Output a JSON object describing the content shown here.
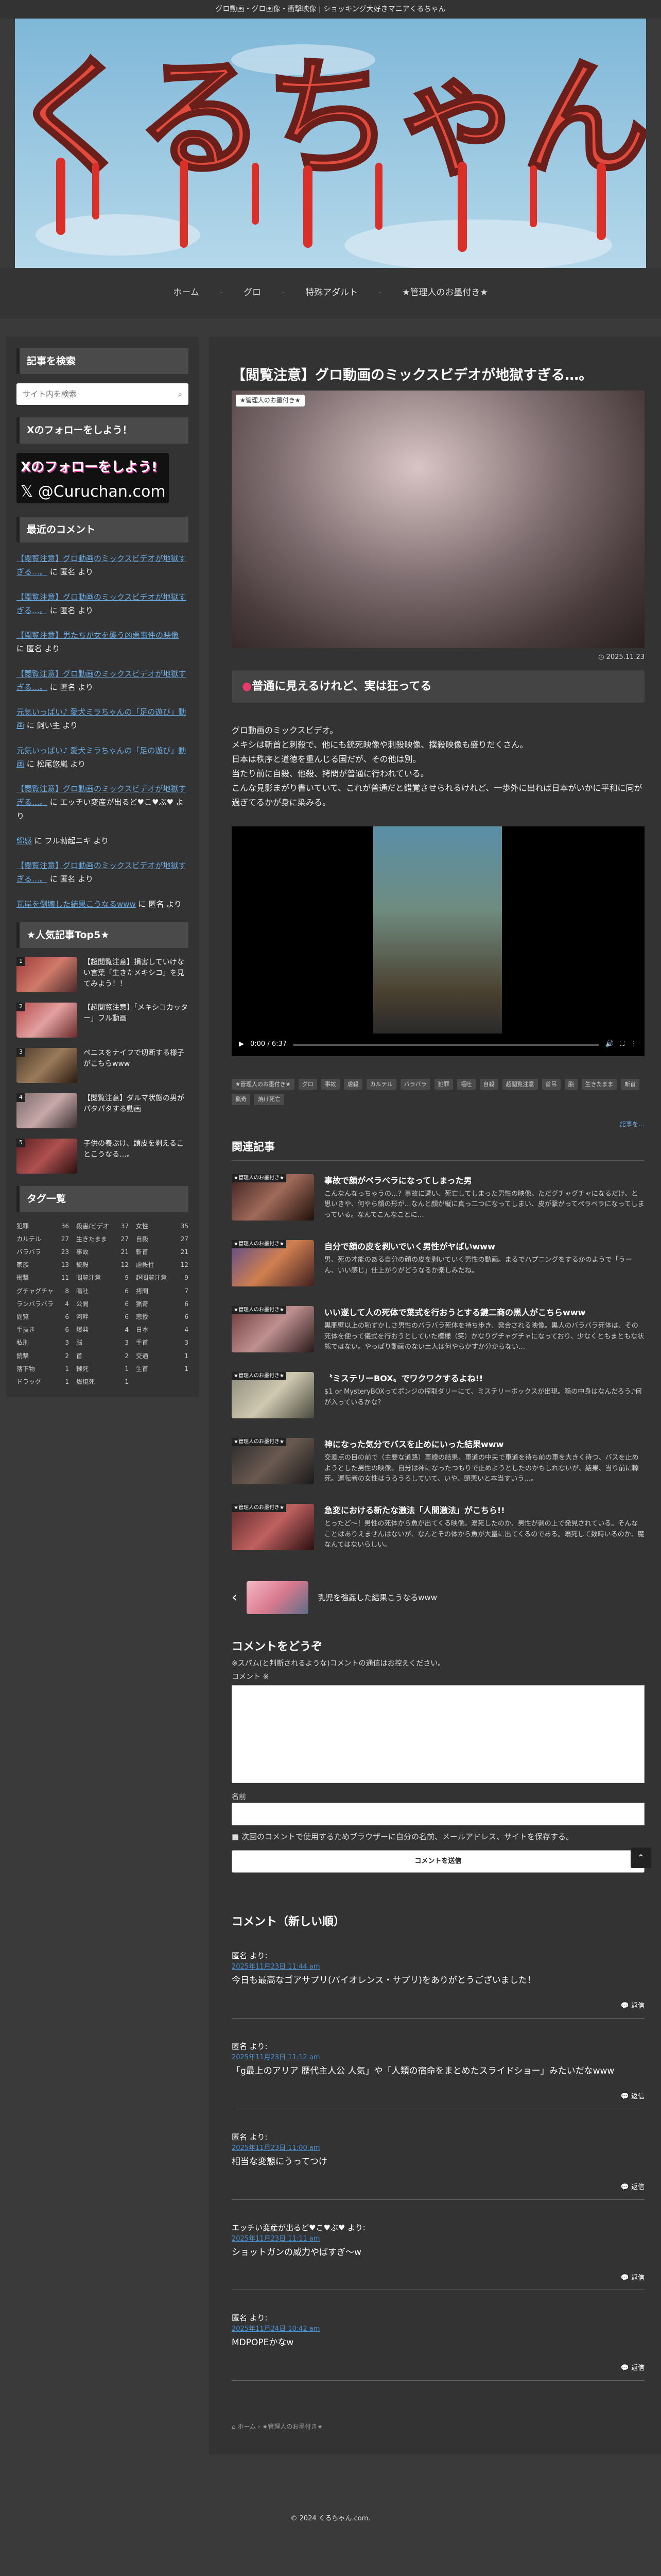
{
  "topbar": "グロ動画・グロ画像・衝撃映像 | ショッキング大好きマニアくるちゃん",
  "logo": "くるちゃん",
  "nav": [
    "ホーム",
    "グロ",
    "特殊アダルト",
    "★管理人のお墨付き★"
  ],
  "sidebar": {
    "search_title": "記事を検索",
    "search_placeholder": "サイト内を検索",
    "follow_title": "Xのフォローをしよう！",
    "follow_line1": "Xのフォローをしよう!",
    "follow_line2": "@Curuchan.com",
    "recent_title": "最近のコメント",
    "recent": [
      {
        "link": "【閲覧注意】グロ動画のミックスビデオが地獄すぎる…。",
        "rest": " に 匿名 より"
      },
      {
        "link": "【閲覧注意】グロ動画のミックスビデオが地獄すぎる…。",
        "rest": " に 匿名 より"
      },
      {
        "link": "【閲覧注意】男たちが女を襲う凶悪事件の映像",
        "rest": " に 匿名 より"
      },
      {
        "link": "【閲覧注意】グロ動画のミックスビデオが地獄すぎる…。",
        "rest": " に 匿名 より"
      },
      {
        "link": "元気いっぱい♪ 愛犬ミラちゃんの「足の遊び」動画",
        "rest": " に 飼い主 より"
      },
      {
        "link": "元気いっぱい♪ 愛犬ミラちゃんの「足の遊び」動画",
        "rest": " に 松尾悠嵐 より"
      },
      {
        "link": "【閲覧注意】グロ動画のミックスビデオが地獄すぎる…。",
        "rest": " に エッチい変産が出るど♥こ♥ぶ♥ より"
      },
      {
        "link": "綿感",
        "rest": " に フル勃起ニキ より"
      },
      {
        "link": "【閲覧注意】グロ動画のミックスビデオが地獄すぎる…。",
        "rest": " に 匿名 より"
      },
      {
        "link": "瓦岸を倒壊した結果こうなるwww",
        "rest": " に 匿名 より"
      }
    ],
    "popular_title": "★人気記事Top5★",
    "popular": [
      {
        "rank": "1",
        "title": "【超閲覧注意】損害していけない言葉「生きたメキシコ」を見てみよう！！"
      },
      {
        "rank": "2",
        "title": "【超閲覧注意】「メキシコカッター」フル動画"
      },
      {
        "rank": "3",
        "title": "ペニスをナイフで切断する様子がこちらwww"
      },
      {
        "rank": "4",
        "title": "【閲覧注意】ダルマ状態の男がパタパタする動画"
      },
      {
        "rank": "5",
        "title": "子供の養ぶけ、頭皮を剥えることこうなる…。"
      }
    ],
    "tags_title": "タグ一覧",
    "tags": [
      [
        "犯罪",
        "36"
      ],
      [
        "殺害/ビデオ",
        "37"
      ],
      [
        "女性",
        "35"
      ],
      [
        "カルテル",
        "27"
      ],
      [
        "生きたまま",
        "27"
      ],
      [
        "自殺",
        "27"
      ],
      [
        "バラバラ",
        "23"
      ],
      [
        "事故",
        "21"
      ],
      [
        "斬首",
        "21"
      ],
      [
        "家族",
        "13"
      ],
      [
        "銃殺",
        "12"
      ],
      [
        "虐殺性",
        "12"
      ],
      [
        "衝撃",
        "11"
      ],
      [
        "閲覧注意",
        "9"
      ],
      [
        "超閲覧注意",
        "9"
      ],
      [
        "グチャグチャ",
        "8"
      ],
      [
        "嘔吐",
        "6"
      ],
      [
        "拷問",
        "7"
      ],
      [
        "ランバラバラ",
        "4"
      ],
      [
        "公開",
        "6"
      ],
      [
        "猟奇",
        "6"
      ],
      [
        "閲覧",
        "6"
      ],
      [
        "河畔",
        "6"
      ],
      [
        "悲惨",
        "6"
      ],
      [
        "手抜き",
        "6"
      ],
      [
        "爆発",
        "4"
      ],
      [
        "日本",
        "4"
      ],
      [
        "私刑",
        "3"
      ],
      [
        "脳",
        "3"
      ],
      [
        "手首",
        "3"
      ],
      [
        "銃撃",
        "2"
      ],
      [
        "首",
        "2"
      ],
      [
        "交通",
        "1"
      ],
      [
        "落下物",
        "1"
      ],
      [
        "轢死",
        "1"
      ],
      [
        "生首",
        "1"
      ],
      [
        "ドラッグ",
        "1"
      ],
      [
        "燃焼死",
        "1"
      ]
    ]
  },
  "post": {
    "title": "【閲覧注意】グロ動画のミックスビデオが地獄すぎる…。",
    "badge": "★管理人のお墨付き★",
    "date": "2025.11.23",
    "headline_dot": "●",
    "headline": "普通に見えるけれど、実は狂ってる",
    "body": [
      "グロ動画のミックスビデオ。",
      "メキシは斬首と刺殺で、他にも銃死映像や刺殺映像、撲殺映像も盛りだくさん。",
      "日本は秩序と道徳を重んじる国だが、その他は別。",
      "当たり前に自殺、他殺、拷問が普通に行われている。",
      "こんな見影まがり書いていて、これが普通だと錯覚させられるけれど、一歩外に出れば日本がいかに平和に同が過ぎてるかが身に染みる。"
    ],
    "video_time": "0:00 / 6:37",
    "cats": [
      "★管理人のお墨付き★",
      "グロ",
      "事故",
      "虐殺",
      "カルテル",
      "バラバラ",
      "犯罪",
      "嘔吐",
      "自殺",
      "超閲覧注意",
      "首吊",
      "脳",
      "生きたまま",
      "斬首",
      "猟奇",
      "焼け死亡"
    ],
    "share": "記事を…"
  },
  "related": {
    "title": "関連記事",
    "items": [
      {
        "title": "事故で顔がベラベラになってしまった男",
        "excerpt": "こんなんなっちゃうの…？事故に遭い、死亡してしまった男性の映像。ただグチャグチャになるだけ、と思いきや、何やら顔の形が…なんと顔が縦に真っ二つになってしまい、皮が繋がってペラペラになってしまっている。なんてこんなことに…"
      },
      {
        "title": "自分で顔の皮を剥いでいく男性がヤばいwww",
        "excerpt": "男、死の才能のある自分の顔の皮を剥いていく男性の動画。まるでハプニングをするかのようで「うーん、いい感じ」仕上がりがどうなるか楽しみだね。"
      },
      {
        "title": "いい遂して人の死体で葉式を行おうとする鍵二商の黒人がこちらwww",
        "excerpt": "黒肥壁以上の恥ずかしさ男性のバラバラ死体を持ち歩き、発合される映像。黒人のバラバラ死体は、その死体を使って儀式を行おうとしていた模様（笑）かなりグチャグチャになっており、少なくともまともな状態ではない。やっぱり動画のない土人は何やらかすか分からない…"
      },
      {
        "title": "〝ミステリーBOX〟でワクワクするよね!!",
        "excerpt": "$1 or MysteryBOXってポンジの搾取ダリーにて、ミステリーボックスが出現。箱の中身はなんだろう♪何が入っているかな？"
      },
      {
        "title": "神になった気分でバスを止めにいった結果www",
        "excerpt": "交差点の目の前で（主要な道路）車線の結果、車道の中央で車道を待ち前の車を大きく待つ、バスを止めようとした男性の映像。自分は神になったつもりで止めようとしたのかもしれないが、結果、当り前に轢死。運転者の女性はうろうろしていて、いや、頭悪いと本当すいう…。"
      },
      {
        "title": "急変における新たな激法「人間激法」がこちら!!",
        "excerpt": "とったど〜！男性の死体から魚が出てくる映像。溺死したのか、男性が剥の上で発見されている。そんなことはありえませんはないが、なんとその体から魚が大量に出てくるのである。溺死して数時いるのか、魔なんてはないらしい。"
      }
    ]
  },
  "pager": {
    "arrow": "‹",
    "title": "乳児を強姦した結果こうなるwww"
  },
  "comment_form": {
    "title": "コメントをどうぞ",
    "note": "※スパム(と判断されるような)コメントの通信はお控えください。",
    "comment_label": "コメント ※",
    "name_label": "名前",
    "save_label": "次回のコメントで使用するためブラウザーに自分の名前、メールアドレス、サイトを保存する。",
    "submit": "コメントを送信"
  },
  "comments": {
    "title": "コメント（新しい順）",
    "items": [
      {
        "who": "匿名 より:",
        "when": "2025年11月23日 11:44 am",
        "text": "今日も最高なゴアサプリ(バイオレンス・サプリ)をありがとうございました！",
        "reply": "返信"
      },
      {
        "who": "匿名 より:",
        "when": "2025年11月23日 11:12 am",
        "text": "「g最上のアリア 歴代主人公 人気」や「人類の宿命をまとめたスライドショー」みたいだなwww",
        "reply": "返信"
      },
      {
        "who": "匿名 より:",
        "when": "2025年11月23日 11:00 am",
        "text": "相当な変態にうってつけ",
        "reply": "返信"
      },
      {
        "who": "エッチい変産が出るど♥こ♥ぶ♥ より:",
        "when": "2025年11月23日 11:11 am",
        "text": "ショットガンの威力やばすぎ〜w",
        "reply": "返信"
      },
      {
        "who": "匿名 より:",
        "when": "2025年11月24日 10:42 am",
        "text": "MDPOPEかなw",
        "reply": "返信"
      }
    ]
  },
  "breadcrumb": [
    "ホーム",
    "★管理人のお墨付き★"
  ],
  "footer": "© 2024 くるちゃん.com.",
  "colors": {
    "bg": "#3a3a3a",
    "panel": "#333333",
    "link": "#6aa9e0",
    "accent": "#e53b6b"
  }
}
